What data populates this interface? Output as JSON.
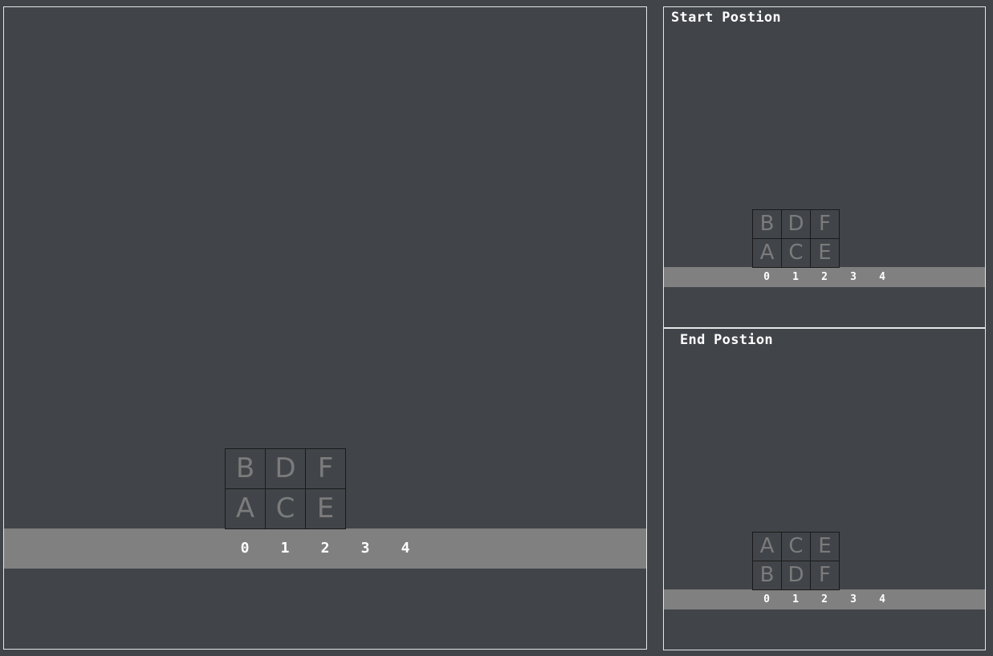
{
  "start_panel": {
    "title": "Start Postion"
  },
  "end_panel": {
    "title": "End Postion"
  },
  "axis": [
    "0",
    "1",
    "2",
    "3",
    "4"
  ],
  "main_board": {
    "stacks": [
      [
        "A",
        "B"
      ],
      [
        "C",
        "D"
      ],
      [
        "E",
        "F"
      ],
      [],
      []
    ]
  },
  "start_board": {
    "stacks": [
      [
        "A",
        "B"
      ],
      [
        "C",
        "D"
      ],
      [
        "E",
        "F"
      ],
      [],
      []
    ]
  },
  "end_board": {
    "stacks": [
      [
        "B",
        "A"
      ],
      [
        "D",
        "C"
      ],
      [
        "F",
        "E"
      ],
      [],
      []
    ]
  }
}
